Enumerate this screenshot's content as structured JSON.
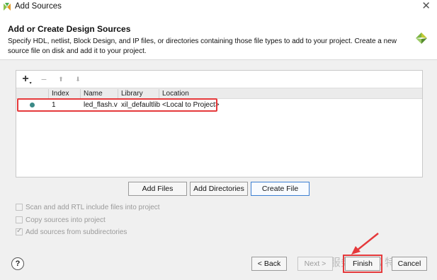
{
  "window": {
    "title": "Add Sources",
    "close_glyph": "✕"
  },
  "header": {
    "heading": "Add or Create Design Sources",
    "description": "Specify HDL, netlist, Block Design, and IP files, or directories containing those file types to add to your project. Create a new source file on disk and add it to your project.",
    "logo_icon": "vivado-logo-icon"
  },
  "toolbar": {
    "add_glyph": "+",
    "remove_glyph": "−",
    "up_glyph": "⬆",
    "down_glyph": "⬇"
  },
  "table": {
    "columns": [
      "Index",
      "Name",
      "Library",
      "Location"
    ],
    "rows": [
      {
        "index": "1",
        "name": "led_flash.v",
        "library": "xil_defaultlib",
        "location": "<Local to Project>"
      }
    ]
  },
  "actions": {
    "add_files": "Add Files",
    "add_directories": "Add Directories",
    "create_file": "Create File"
  },
  "options": {
    "scan_rtl": {
      "label": "Scan and add RTL include files into project",
      "checked": false
    },
    "copy_sources": {
      "label": "Copy sources into project",
      "checked": false
    },
    "add_subdirs": {
      "label": "Add sources from subdirectories",
      "checked": true
    }
  },
  "footer": {
    "help": "?",
    "back": "< Back",
    "next": "Next >",
    "finish": "Finish",
    "cancel": "Cancel"
  },
  "watermark": "⊛ 服务号 · 芯 特",
  "colors": {
    "highlight": "#e5393b",
    "status_dot": "#3b8a87",
    "primary_border": "#3c7fd2"
  }
}
